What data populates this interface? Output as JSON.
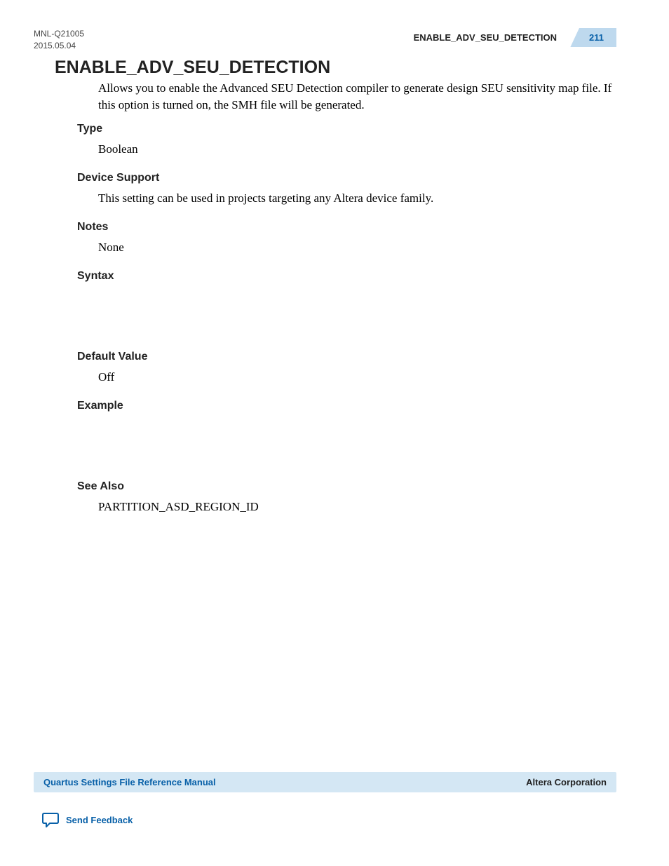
{
  "header": {
    "doc_id": "MNL-Q21005",
    "date": "2015.05.04",
    "topic": "ENABLE_ADV_SEU_DETECTION",
    "page": "211"
  },
  "title": "ENABLE_ADV_SEU_DETECTION",
  "description": "Allows you to enable the Advanced SEU Detection compiler to generate design SEU sensitivity map file. If this option is turned on, the SMH file will be generated.",
  "sections": {
    "type": {
      "heading": "Type",
      "body": "Boolean"
    },
    "device": {
      "heading": "Device Support",
      "body": "This setting can be used in projects targeting any Altera device family."
    },
    "notes": {
      "heading": "Notes",
      "body": "None"
    },
    "syntax": {
      "heading": "Syntax",
      "body": ""
    },
    "default": {
      "heading": "Default Value",
      "body": "Off"
    },
    "example": {
      "heading": "Example",
      "body": ""
    },
    "seealso": {
      "heading": "See Also",
      "body": "PARTITION_ASD_REGION_ID"
    }
  },
  "footer": {
    "manual": "Quartus Settings File Reference Manual",
    "company": "Altera Corporation",
    "feedback": "Send Feedback"
  }
}
